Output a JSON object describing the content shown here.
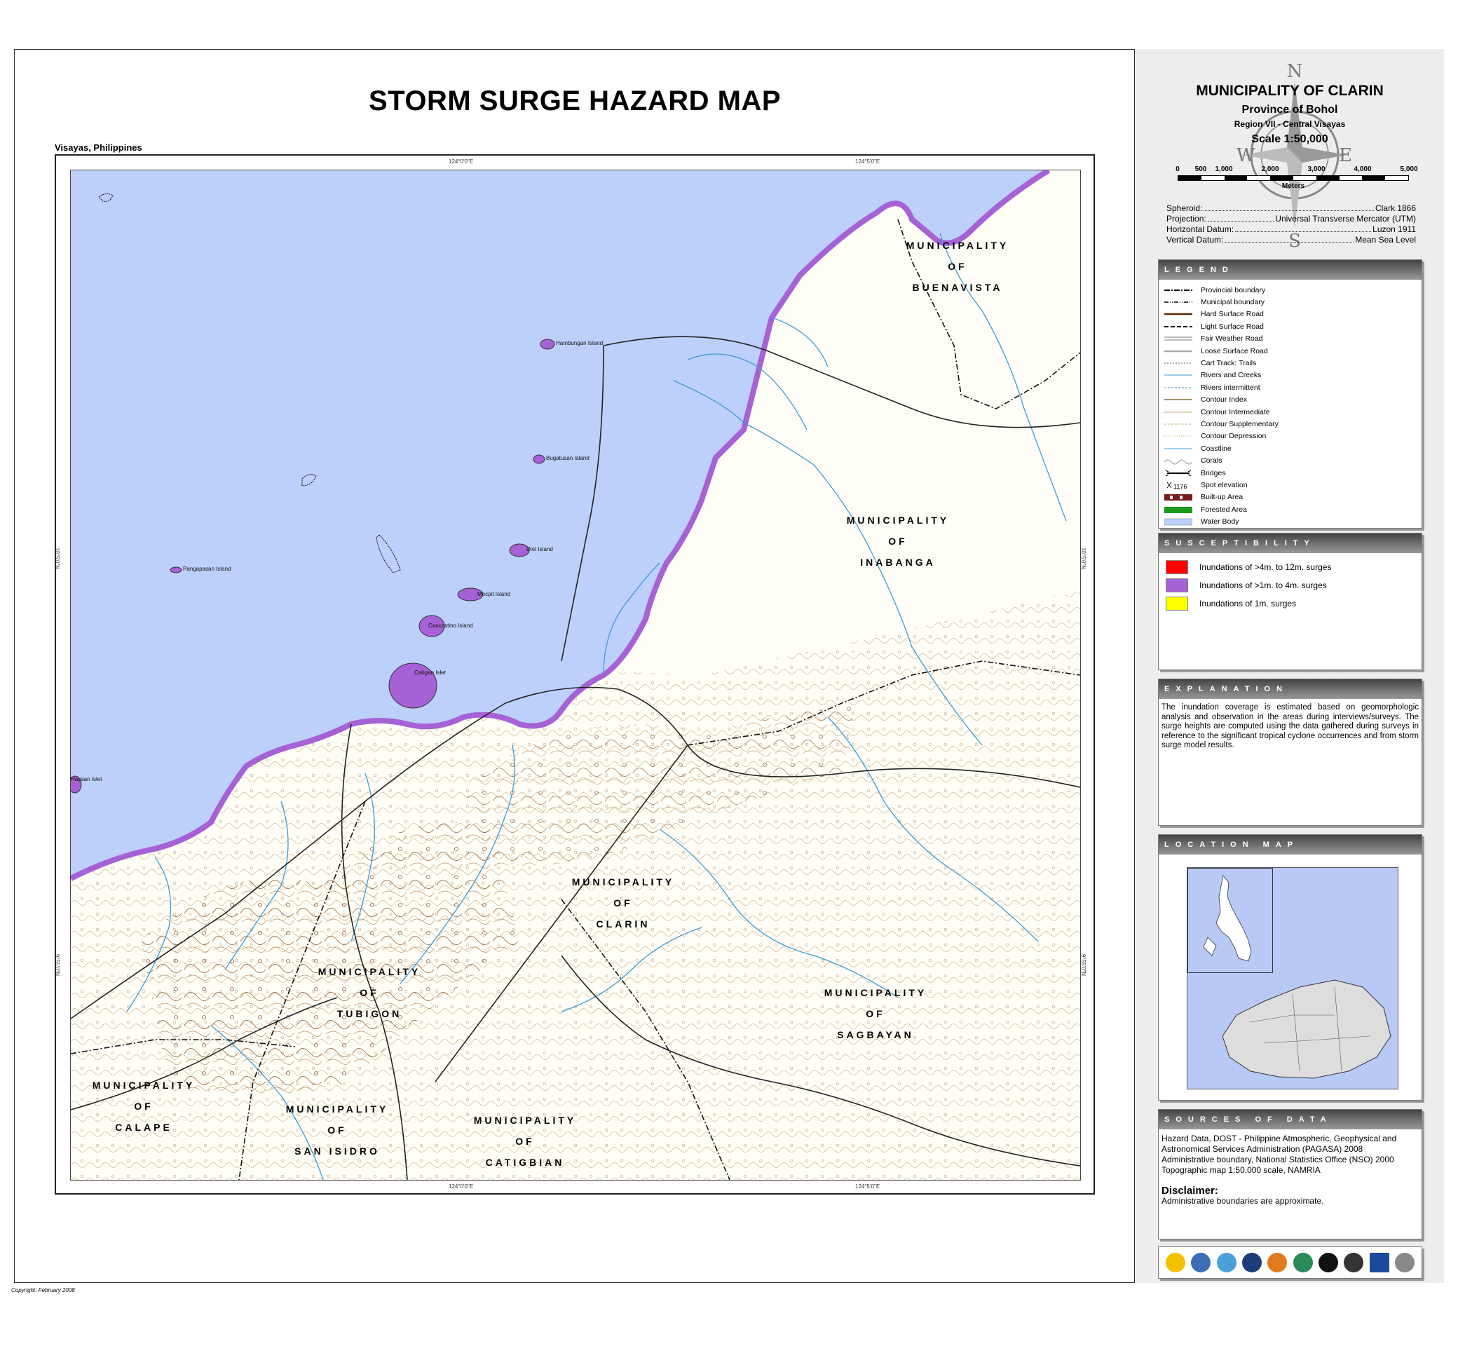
{
  "title": "STORM SURGE HAZARD MAP",
  "region_label": "Visayas, Philippines",
  "copyright": "Copyright: February 2008",
  "map": {
    "grid_labels": {
      "top_left": "124°0'0\"E",
      "top_right": "124°5'0\"E",
      "bottom_left": "124°0'0\"E",
      "bottom_right": "124°5'0\"E",
      "left_mid": "10°5'0\"N",
      "left_low": "9°55'0\"N",
      "right_mid": "10°5'0\"N",
      "right_low": "9°55'0\"N"
    },
    "municipalities": [
      {
        "id": "buenavista",
        "name": "MUNICIPALITY\nOF\nBUENAVISTA"
      },
      {
        "id": "inabanga",
        "name": "MUNICIPALITY\nOF\nINABANGA"
      },
      {
        "id": "clarin",
        "name": "MUNICIPALITY\nOF\nCLARIN"
      },
      {
        "id": "tubigon",
        "name": "MUNICIPALITY\nOF\nTUBIGON"
      },
      {
        "id": "sagbayan",
        "name": "MUNICIPALITY\nOF\nSAGBAYAN"
      },
      {
        "id": "calape",
        "name": "MUNICIPALITY\nOF\nCALAPE"
      },
      {
        "id": "san_isidro",
        "name": "MUNICIPALITY\nOF\nSAN ISIDRO"
      },
      {
        "id": "catigbian",
        "name": "MUNICIPALITY\nOF\nCATIGBIAN"
      }
    ],
    "islands": [
      "Hambungan Island",
      "Bugatusan Island",
      "Pangapasan Island",
      "Diot Island",
      "Mocpit Island",
      "Cancostino Island",
      "Cabgan Islet",
      "Hayaan Islet"
    ]
  },
  "panel": {
    "municipality": "MUNICIPALITY OF CLARIN",
    "province": "Province of Bohol",
    "region": "Region VII - Central Visayas",
    "scale": "Scale 1:50,000",
    "compass": {
      "n": "N",
      "s": "S",
      "e": "E",
      "w": "W"
    },
    "scale_ticks": [
      "0",
      "500",
      "1,000",
      "2,000",
      "3,000",
      "4,000",
      "5,000"
    ],
    "scale_units": "Meters",
    "geodetic": [
      {
        "label": "Spheroid:",
        "value": "Clark 1866"
      },
      {
        "label": "Projection:",
        "value": "Universal Transverse Mercator (UTM)"
      },
      {
        "label": "Horizontal Datum:",
        "value": "Luzon 1911"
      },
      {
        "label": "Vertical Datum:",
        "value": "Mean Sea Level"
      }
    ]
  },
  "legend": {
    "title": "LEGEND",
    "items": [
      {
        "label": "Provincial boundary",
        "style": "provincial"
      },
      {
        "label": "Municipal boundary",
        "style": "municipal"
      },
      {
        "label": "Hard Surface Road",
        "style": "hard"
      },
      {
        "label": "Light Surface Road",
        "style": "light"
      },
      {
        "label": "Fair Weather Road",
        "style": "fair"
      },
      {
        "label": "Loose Surface Road",
        "style": "loose"
      },
      {
        "label": "Cart Track: Trails",
        "style": "cart"
      },
      {
        "label": "Rivers and Creeks",
        "style": "river"
      },
      {
        "label": "Rivers intermittent",
        "style": "river-int"
      },
      {
        "label": "Contour Index",
        "style": "contour-index"
      },
      {
        "label": "Contour Intermediate",
        "style": "contour-inter"
      },
      {
        "label": "Contour Supplementary",
        "style": "contour-supp"
      },
      {
        "label": "Contour Depression",
        "style": "contour-dep"
      },
      {
        "label": "Coastline",
        "style": "coast"
      },
      {
        "label": "Corals",
        "style": "corals"
      },
      {
        "label": "Bridges",
        "style": "bridges"
      },
      {
        "label": "Spot elevation",
        "style": "spot"
      },
      {
        "label": "Built-up Area",
        "style": "built"
      },
      {
        "label": "Forested Area",
        "style": "forest"
      },
      {
        "label": "Water Body",
        "style": "water"
      }
    ]
  },
  "susceptibility": {
    "title": "SUSCEPTIBILITY",
    "items": [
      {
        "label": "Inundations of >4m. to 12m. surges",
        "color": "#ff0000"
      },
      {
        "label": "Inundations of >1m. to 4m. surges",
        "color": "#a661d6"
      },
      {
        "label": "Inundations of 1m. surges",
        "color": "#ffff00"
      }
    ]
  },
  "explanation": {
    "title": "EXPLANATION",
    "text": "The inundation coverage is estimated based on geomorphologic analysis and observation in the areas during interviews/surveys. The surge heights are computed using the data gathered during surveys in reference to the significant tropical cyclone occurrences and from storm surge model results."
  },
  "location_map": {
    "title": "LOCATION MAP"
  },
  "sources": {
    "title": "SOURCES OF DATA",
    "lines": [
      "Hazard Data, DOST - Philippine Atmospheric, Geophysical and Astronomical Services Administration (PAGASA) 2008",
      "Administrative boundary, National Statistics Office (NSO) 2000",
      "Topographic map 1:50,000 scale, NAMRIA"
    ],
    "disclaimer_title": "Disclaimer:",
    "disclaimer_text": "Administrative boundaries are approximate."
  },
  "colors": {
    "sea": "#bdd0fb",
    "surge_zone": "#a661d6",
    "land": "#fffef6",
    "river": "#3a9bd5",
    "contour": "#b59a6a"
  }
}
